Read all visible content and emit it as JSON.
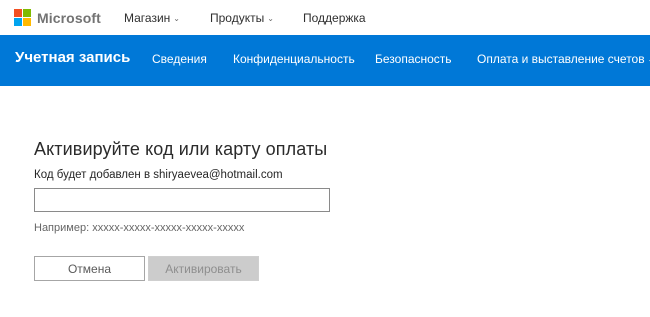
{
  "header": {
    "brand": "Microsoft",
    "nav": [
      {
        "label": "Магазин",
        "has_dropdown": true
      },
      {
        "label": "Продукты",
        "has_dropdown": true
      },
      {
        "label": "Поддержка",
        "has_dropdown": false
      }
    ],
    "logo_colors": [
      "#f25022",
      "#7fba00",
      "#00a4ef",
      "#ffb900"
    ]
  },
  "account_bar": {
    "title": "Учетная запись",
    "items": [
      {
        "label": "Сведения"
      },
      {
        "label": "Конфиденциальность"
      },
      {
        "label": "Безопасность"
      },
      {
        "label": "Оплата и выставление счетов",
        "has_dropdown": true
      }
    ],
    "background_color": "#0078d7"
  },
  "form": {
    "heading": "Активируйте код или карту оплаты",
    "note": "Код будет добавлен в shiryaevea@hotmail.com",
    "code_value": "",
    "example": "Например: xxxxx-xxxxx-xxxxx-xxxxx-xxxxx",
    "cancel_label": "Отмена",
    "activate_label": "Активировать"
  }
}
